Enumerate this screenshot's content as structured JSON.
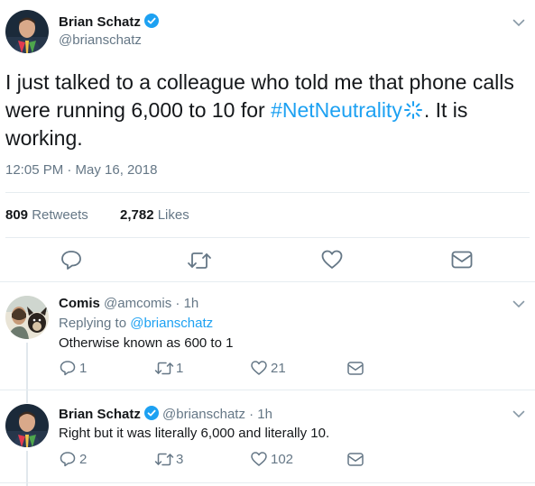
{
  "main_tweet": {
    "author_name": "Brian Schatz",
    "handle": "@brianschatz",
    "text_before": "I just talked to a colleague who told me that phone calls were running 6,000 to 10 for ",
    "hashtag": "#NetNeutrality",
    "text_after": ". It is working.",
    "timestamp": "12:05 PM · May 16, 2018",
    "retweet_count": "809",
    "retweet_label": "Retweets",
    "like_count": "2,782",
    "like_label": "Likes"
  },
  "replies": [
    {
      "author_name": "Comis",
      "handle": "@amcomis",
      "time": "· 1h",
      "replying_label": "Replying to",
      "replying_to": "@brianschatz",
      "text": "Otherwise known as 600 to 1",
      "reply_count": "1",
      "retweet_count": "1",
      "like_count": "21"
    },
    {
      "author_name": "Brian Schatz",
      "handle": "@brianschatz",
      "time": "· 1h",
      "text": "Right but it was literally 6,000 and literally 10.",
      "reply_count": "2",
      "retweet_count": "3",
      "like_count": "102"
    }
  ],
  "icons": {
    "verified": "verified-badge-icon",
    "reply": "reply-icon",
    "retweet": "retweet-icon",
    "like": "heart-icon",
    "dm": "envelope-icon",
    "more": "chevron-down-icon"
  },
  "colors": {
    "accent": "#1da1f2",
    "muted": "#657786",
    "divider": "#e6ecf0"
  }
}
